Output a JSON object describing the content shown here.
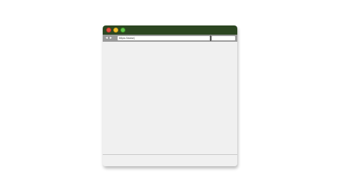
{
  "browser": {
    "window_controls": {
      "close_color": "#e64f42",
      "minimize_color": "#f2c12e",
      "maximize_color": "#62c34a"
    },
    "titlebar_color": "#2c4621",
    "toolbar": {
      "back_icon": "◂",
      "forward_icon": "▸",
      "address": "https://www|",
      "search_value": ""
    }
  }
}
